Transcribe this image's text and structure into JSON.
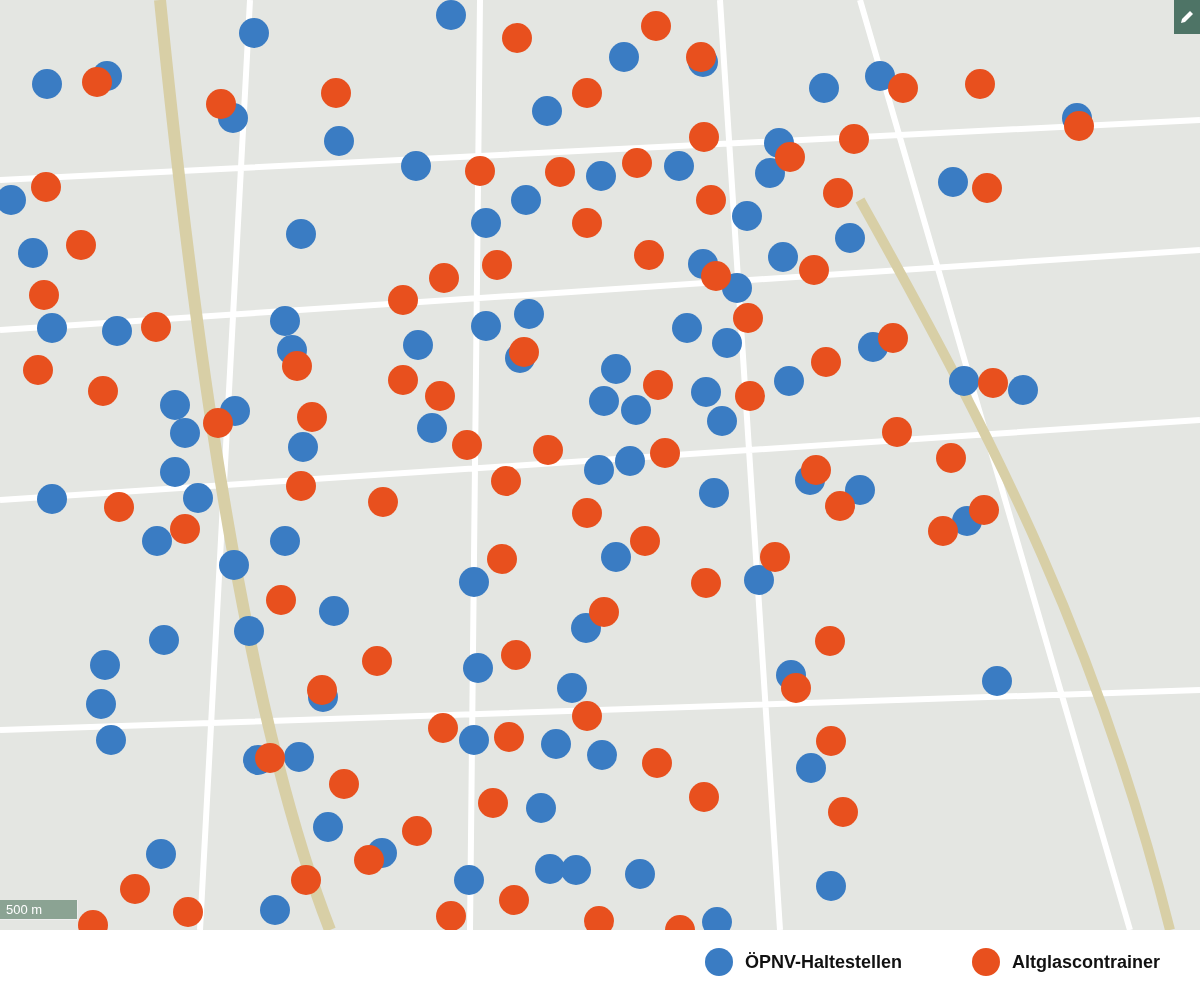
{
  "map": {
    "scale": "500 m"
  },
  "legend": [
    {
      "label": "ÖPNV-Haltestellen",
      "color": "#3a7cc3"
    },
    {
      "label": "Altglascontrainer",
      "color": "#e8501e"
    }
  ]
}
